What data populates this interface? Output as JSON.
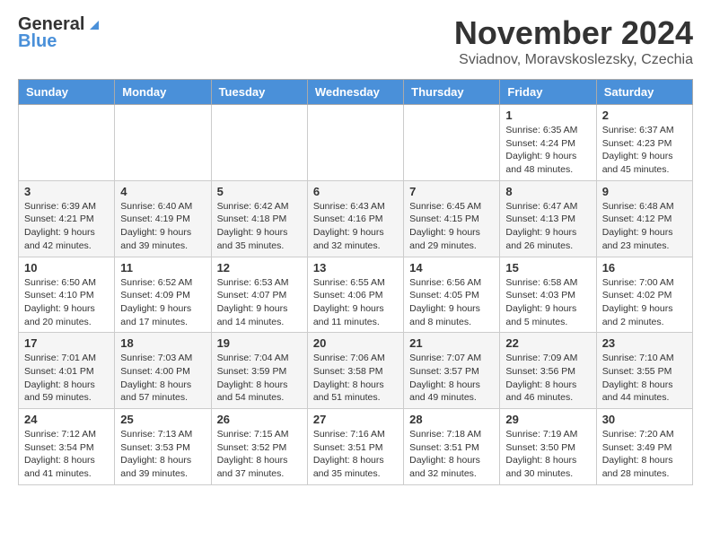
{
  "header": {
    "logo_general": "General",
    "logo_blue": "Blue",
    "month_title": "November 2024",
    "subtitle": "Sviadnov, Moravskoslezsky, Czechia"
  },
  "days_of_week": [
    "Sunday",
    "Monday",
    "Tuesday",
    "Wednesday",
    "Thursday",
    "Friday",
    "Saturday"
  ],
  "weeks": [
    [
      {
        "day": "",
        "info": ""
      },
      {
        "day": "",
        "info": ""
      },
      {
        "day": "",
        "info": ""
      },
      {
        "day": "",
        "info": ""
      },
      {
        "day": "",
        "info": ""
      },
      {
        "day": "1",
        "info": "Sunrise: 6:35 AM\nSunset: 4:24 PM\nDaylight: 9 hours and 48 minutes."
      },
      {
        "day": "2",
        "info": "Sunrise: 6:37 AM\nSunset: 4:23 PM\nDaylight: 9 hours and 45 minutes."
      }
    ],
    [
      {
        "day": "3",
        "info": "Sunrise: 6:39 AM\nSunset: 4:21 PM\nDaylight: 9 hours and 42 minutes."
      },
      {
        "day": "4",
        "info": "Sunrise: 6:40 AM\nSunset: 4:19 PM\nDaylight: 9 hours and 39 minutes."
      },
      {
        "day": "5",
        "info": "Sunrise: 6:42 AM\nSunset: 4:18 PM\nDaylight: 9 hours and 35 minutes."
      },
      {
        "day": "6",
        "info": "Sunrise: 6:43 AM\nSunset: 4:16 PM\nDaylight: 9 hours and 32 minutes."
      },
      {
        "day": "7",
        "info": "Sunrise: 6:45 AM\nSunset: 4:15 PM\nDaylight: 9 hours and 29 minutes."
      },
      {
        "day": "8",
        "info": "Sunrise: 6:47 AM\nSunset: 4:13 PM\nDaylight: 9 hours and 26 minutes."
      },
      {
        "day": "9",
        "info": "Sunrise: 6:48 AM\nSunset: 4:12 PM\nDaylight: 9 hours and 23 minutes."
      }
    ],
    [
      {
        "day": "10",
        "info": "Sunrise: 6:50 AM\nSunset: 4:10 PM\nDaylight: 9 hours and 20 minutes."
      },
      {
        "day": "11",
        "info": "Sunrise: 6:52 AM\nSunset: 4:09 PM\nDaylight: 9 hours and 17 minutes."
      },
      {
        "day": "12",
        "info": "Sunrise: 6:53 AM\nSunset: 4:07 PM\nDaylight: 9 hours and 14 minutes."
      },
      {
        "day": "13",
        "info": "Sunrise: 6:55 AM\nSunset: 4:06 PM\nDaylight: 9 hours and 11 minutes."
      },
      {
        "day": "14",
        "info": "Sunrise: 6:56 AM\nSunset: 4:05 PM\nDaylight: 9 hours and 8 minutes."
      },
      {
        "day": "15",
        "info": "Sunrise: 6:58 AM\nSunset: 4:03 PM\nDaylight: 9 hours and 5 minutes."
      },
      {
        "day": "16",
        "info": "Sunrise: 7:00 AM\nSunset: 4:02 PM\nDaylight: 9 hours and 2 minutes."
      }
    ],
    [
      {
        "day": "17",
        "info": "Sunrise: 7:01 AM\nSunset: 4:01 PM\nDaylight: 8 hours and 59 minutes."
      },
      {
        "day": "18",
        "info": "Sunrise: 7:03 AM\nSunset: 4:00 PM\nDaylight: 8 hours and 57 minutes."
      },
      {
        "day": "19",
        "info": "Sunrise: 7:04 AM\nSunset: 3:59 PM\nDaylight: 8 hours and 54 minutes."
      },
      {
        "day": "20",
        "info": "Sunrise: 7:06 AM\nSunset: 3:58 PM\nDaylight: 8 hours and 51 minutes."
      },
      {
        "day": "21",
        "info": "Sunrise: 7:07 AM\nSunset: 3:57 PM\nDaylight: 8 hours and 49 minutes."
      },
      {
        "day": "22",
        "info": "Sunrise: 7:09 AM\nSunset: 3:56 PM\nDaylight: 8 hours and 46 minutes."
      },
      {
        "day": "23",
        "info": "Sunrise: 7:10 AM\nSunset: 3:55 PM\nDaylight: 8 hours and 44 minutes."
      }
    ],
    [
      {
        "day": "24",
        "info": "Sunrise: 7:12 AM\nSunset: 3:54 PM\nDaylight: 8 hours and 41 minutes."
      },
      {
        "day": "25",
        "info": "Sunrise: 7:13 AM\nSunset: 3:53 PM\nDaylight: 8 hours and 39 minutes."
      },
      {
        "day": "26",
        "info": "Sunrise: 7:15 AM\nSunset: 3:52 PM\nDaylight: 8 hours and 37 minutes."
      },
      {
        "day": "27",
        "info": "Sunrise: 7:16 AM\nSunset: 3:51 PM\nDaylight: 8 hours and 35 minutes."
      },
      {
        "day": "28",
        "info": "Sunrise: 7:18 AM\nSunset: 3:51 PM\nDaylight: 8 hours and 32 minutes."
      },
      {
        "day": "29",
        "info": "Sunrise: 7:19 AM\nSunset: 3:50 PM\nDaylight: 8 hours and 30 minutes."
      },
      {
        "day": "30",
        "info": "Sunrise: 7:20 AM\nSunset: 3:49 PM\nDaylight: 8 hours and 28 minutes."
      }
    ]
  ]
}
